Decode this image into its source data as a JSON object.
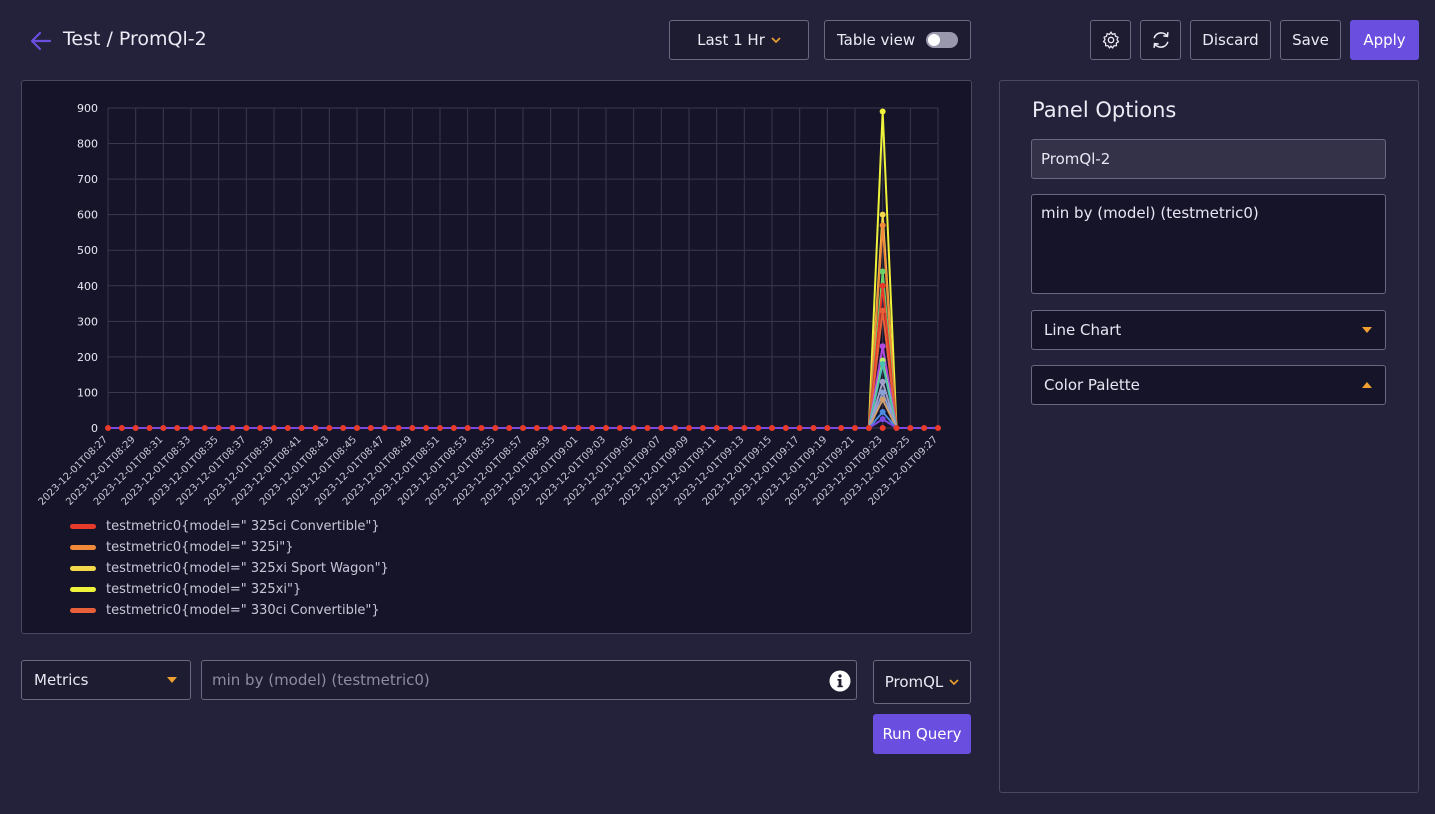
{
  "header": {
    "title": "Test / PromQl-2",
    "time_range": "Last 1 Hr",
    "table_view_label": "Table view",
    "table_view_enabled": false,
    "discard_label": "Discard",
    "save_label": "Save",
    "apply_label": "Apply"
  },
  "colors": {
    "accent": "#6a4ee0",
    "caret": "#f0a030",
    "background": "#24223a",
    "chart_background": "#161428"
  },
  "icons": {
    "back": "arrow-left-icon",
    "settings": "gear-icon",
    "refresh": "refresh-icon",
    "info": "info-icon",
    "caret": "chevron-down-icon"
  },
  "query": {
    "source": "Metrics",
    "placeholder": "min by (model) (testmetric0)",
    "language": "PromQL",
    "run_label": "Run Query"
  },
  "options": {
    "title": "Panel Options",
    "panel_name": "PromQl-2",
    "query": "min by (model) (testmetric0)",
    "chart_type": "Line Chart",
    "palette_label": "Color Palette"
  },
  "chart_data": {
    "type": "line",
    "ylim": [
      0,
      900
    ],
    "yticks": [
      0,
      100,
      200,
      300,
      400,
      500,
      600,
      700,
      800,
      900
    ],
    "grid": true,
    "legend_position": "bottom-left",
    "xticks": [
      "2023-12-01T08:27",
      "2023-12-01T08:29",
      "2023-12-01T08:31",
      "2023-12-01T08:33",
      "2023-12-01T08:35",
      "2023-12-01T08:37",
      "2023-12-01T08:39",
      "2023-12-01T08:41",
      "2023-12-01T08:43",
      "2023-12-01T08:45",
      "2023-12-01T08:47",
      "2023-12-01T08:49",
      "2023-12-01T08:51",
      "2023-12-01T08:53",
      "2023-12-01T08:55",
      "2023-12-01T08:57",
      "2023-12-01T08:59",
      "2023-12-01T09:01",
      "2023-12-01T09:03",
      "2023-12-01T09:05",
      "2023-12-01T09:07",
      "2023-12-01T09:09",
      "2023-12-01T09:11",
      "2023-12-01T09:13",
      "2023-12-01T09:15",
      "2023-12-01T09:17",
      "2023-12-01T09:19",
      "2023-12-01T09:21",
      "2023-12-01T09:23",
      "2023-12-01T09:25",
      "2023-12-01T09:27"
    ],
    "x_points": 61,
    "peak_index": 56,
    "series": [
      {
        "name": "testmetric0{model=\" 325ci Convertible\"}",
        "color": "#e83a2a",
        "peak": 400,
        "legend": true
      },
      {
        "name": "testmetric0{model=\" 325i\"}",
        "color": "#f08a3a",
        "peak": 570,
        "legend": true
      },
      {
        "name": "testmetric0{model=\" 325xi Sport Wagon\"}",
        "color": "#f2d84a",
        "peak": 600,
        "legend": true
      },
      {
        "name": "testmetric0{model=\" 325xi\"}",
        "color": "#eef23a",
        "peak": 890,
        "legend": true
      },
      {
        "name": "testmetric0{model=\" 330ci Convertible\"}",
        "color": "#e8603a",
        "peak": 330,
        "legend": true
      },
      {
        "name": "",
        "color": "#6ad06a",
        "peak": 440,
        "legend": false
      },
      {
        "name": "",
        "color": "#b04ae0",
        "peak": 230,
        "legend": false
      },
      {
        "name": "",
        "color": "#4ac0b0",
        "peak": 180,
        "legend": false
      },
      {
        "name": "",
        "color": "#b8e86a",
        "peak": 190,
        "legend": false
      },
      {
        "name": "",
        "color": "#a0a0c8",
        "peak": 130,
        "legend": false
      },
      {
        "name": "",
        "color": "#8aa0d8",
        "peak": 100,
        "legend": false
      },
      {
        "name": "",
        "color": "#d0a070",
        "peak": 80,
        "legend": false
      },
      {
        "name": "",
        "color": "#4a8ae0",
        "peak": 45,
        "legend": false
      },
      {
        "name": "",
        "color": "#7a4ae0",
        "peak": 25,
        "legend": false
      }
    ]
  }
}
